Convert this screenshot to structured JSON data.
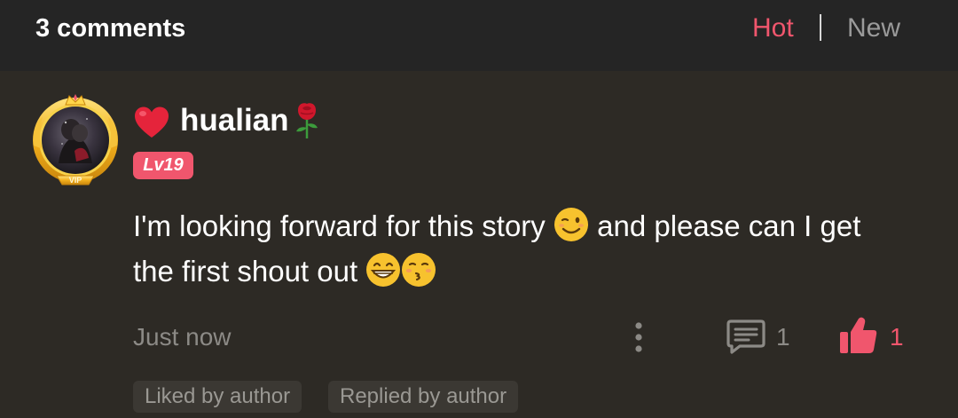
{
  "header": {
    "comments_count": "3 comments",
    "sort_hot": "Hot",
    "sort_new": "New"
  },
  "comment": {
    "username": "hualian",
    "level": "Lv19",
    "text_line1": "I'm looking forward for this story",
    "text_line1b": "and please can I get",
    "text_line2": "the first shout out",
    "timestamp": "Just now",
    "reply_count": "1",
    "like_count": "1",
    "tags": [
      "Liked by author",
      "Replied by author"
    ],
    "avatar_badge": "VIP"
  },
  "colors": {
    "accent": "#f0566d",
    "background": "#2d2a25",
    "header_bg": "#252525",
    "muted_text": "#8c8a86",
    "tag_bg": "#3b3833",
    "gold": "#f2c12e"
  },
  "icons": {
    "user_prefix": "heart-icon",
    "user_suffix": "rose-icon",
    "menu": "more-vertical-icon",
    "reply": "comment-icon",
    "like": "thumbs-up-icon"
  }
}
